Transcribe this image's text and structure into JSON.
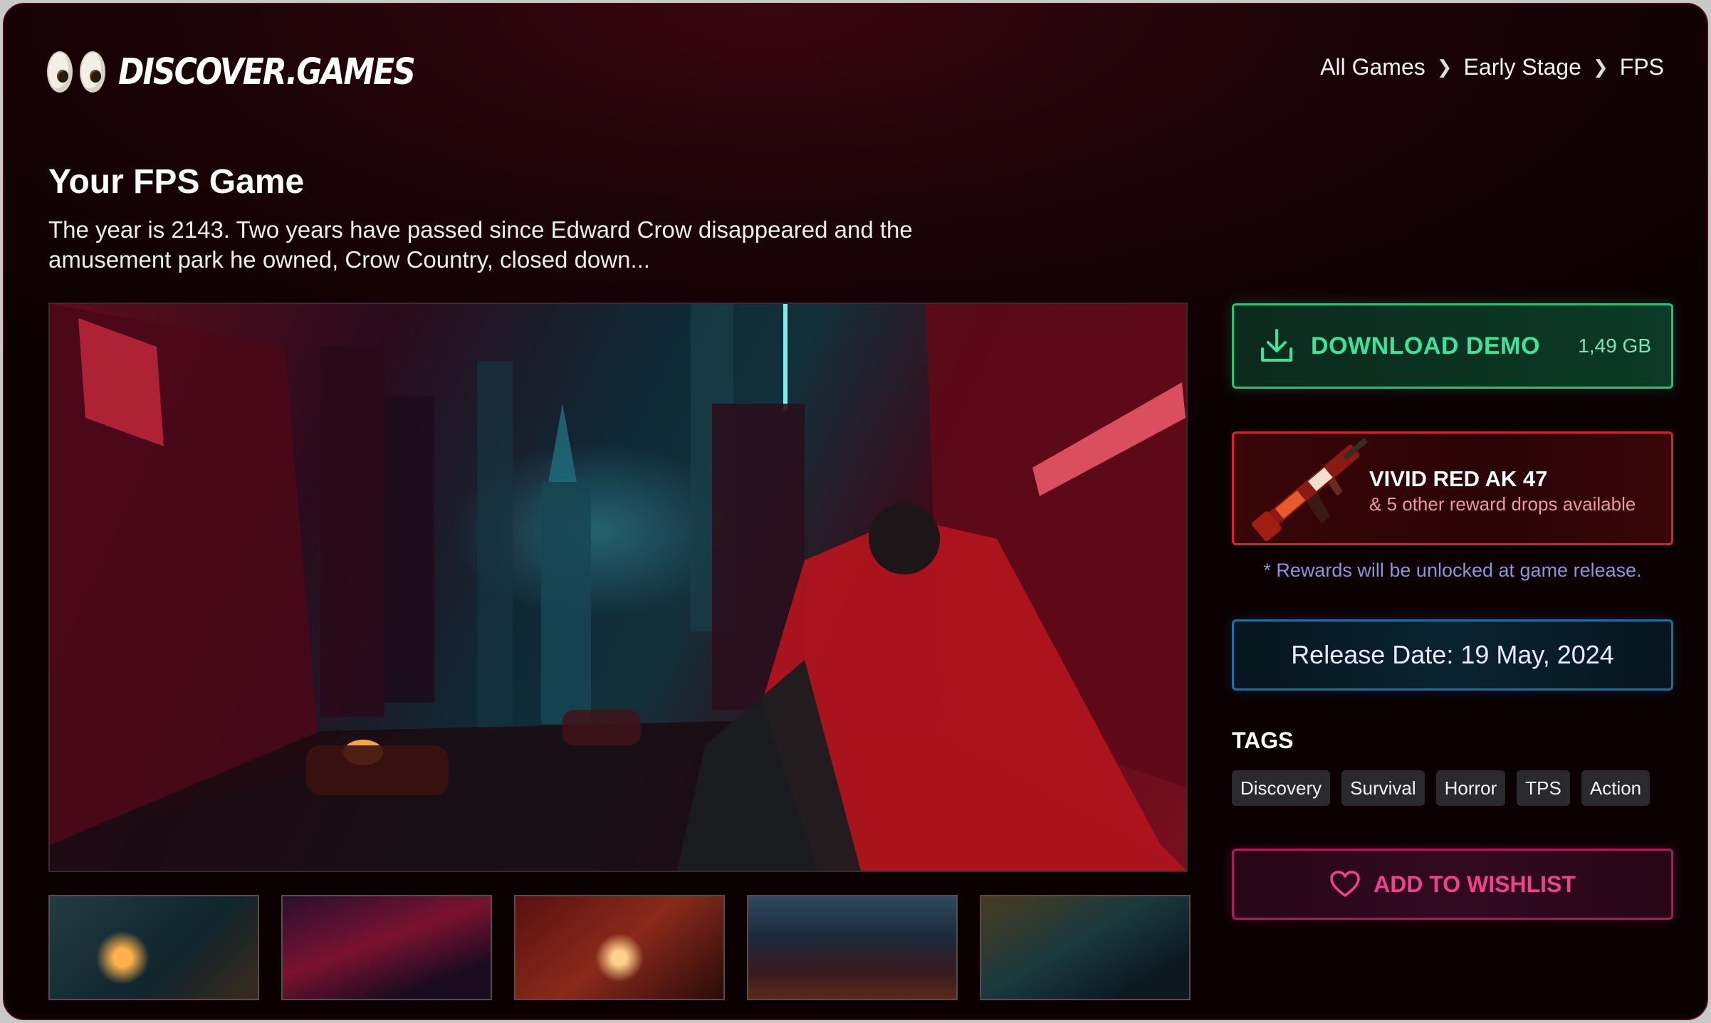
{
  "header": {
    "logo_text": "DISCOVER.GAMES",
    "breadcrumb": [
      "All Games",
      "Early Stage",
      "FPS"
    ]
  },
  "game": {
    "title": "Your FPS Game",
    "description": "The year is 2143. Two years have passed since Edward Crow disappeared and the amusement park he owned, Crow Country, closed down..."
  },
  "download": {
    "label": "DOWNLOAD DEMO",
    "size": "1,49 GB",
    "icon": "download-icon"
  },
  "reward": {
    "name": "VIVID RED AK 47",
    "subtitle": "& 5 other reward drops available",
    "note": "* Rewards will be unlocked at game release."
  },
  "release": {
    "label": "Release Date: 19 May, 2024"
  },
  "tags": {
    "title": "TAGS",
    "items": [
      "Discovery",
      "Survival",
      "Horror",
      "TPS",
      "Action"
    ]
  },
  "wishlist": {
    "label": "ADD TO WISHLIST",
    "icon": "heart-icon"
  },
  "colors": {
    "download_accent": "#3ee39a",
    "reward_accent": "#d8202e",
    "release_accent": "#1e6fa8",
    "wishlist_accent": "#f0418f"
  }
}
